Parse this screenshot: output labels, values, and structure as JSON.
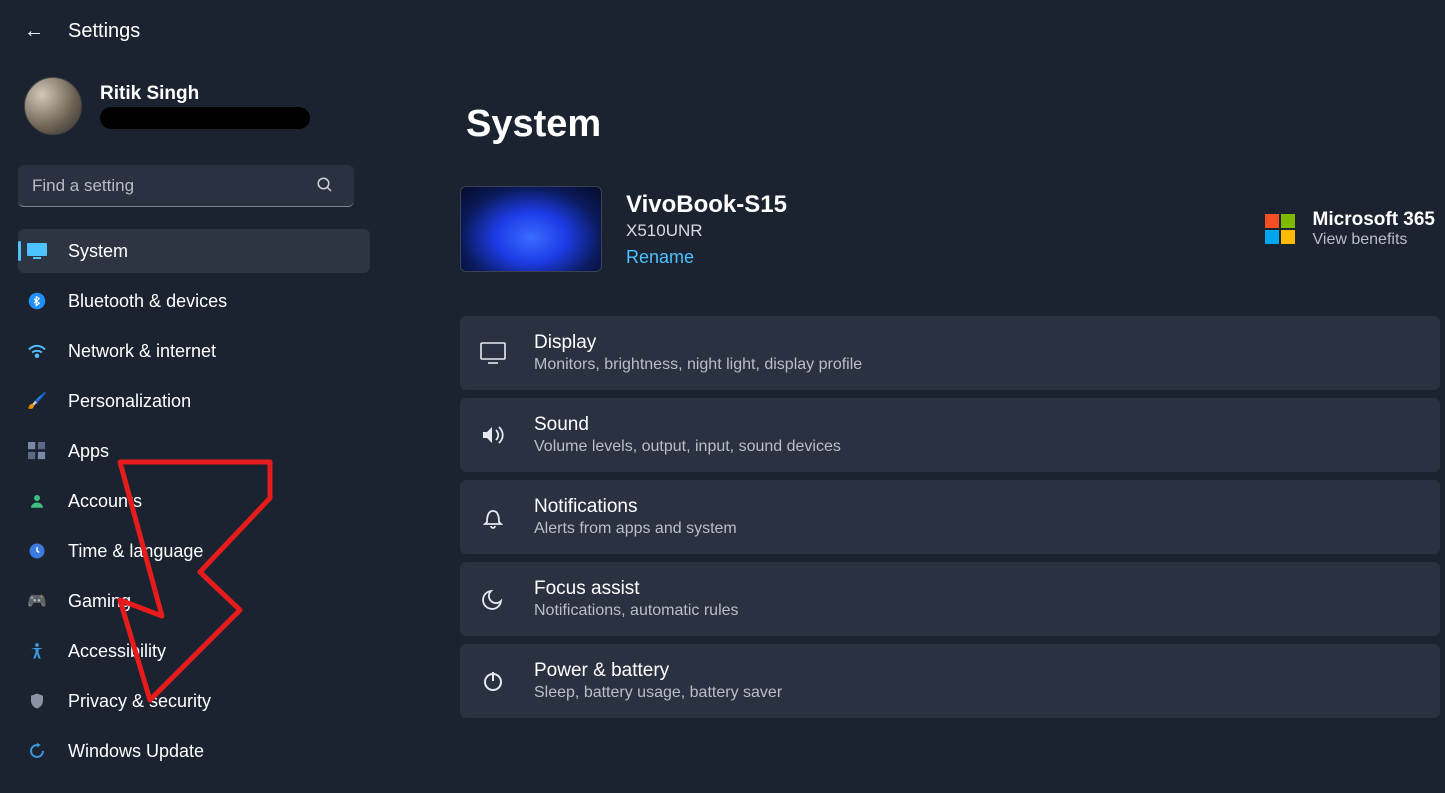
{
  "header": {
    "title": "Settings"
  },
  "user": {
    "name": "Ritik Singh"
  },
  "search": {
    "placeholder": "Find a setting"
  },
  "sidebar": {
    "items": [
      {
        "label": "System",
        "icon": "🖥️",
        "active": true
      },
      {
        "label": "Bluetooth & devices",
        "icon": "bt"
      },
      {
        "label": "Network & internet",
        "icon": "wifi"
      },
      {
        "label": "Personalization",
        "icon": "🖌️"
      },
      {
        "label": "Apps",
        "icon": "▦"
      },
      {
        "label": "Accounts",
        "icon": "👤"
      },
      {
        "label": "Time & language",
        "icon": "🕒"
      },
      {
        "label": "Gaming",
        "icon": "🎮"
      },
      {
        "label": "Accessibility",
        "icon": "acc"
      },
      {
        "label": "Privacy & security",
        "icon": "🛡️"
      },
      {
        "label": "Windows Update",
        "icon": "🔄"
      }
    ]
  },
  "page": {
    "title": "System",
    "device": {
      "name": "VivoBook-S15",
      "model": "X510UNR",
      "rename_label": "Rename"
    },
    "ms365": {
      "title": "Microsoft 365",
      "subtitle": "View benefits"
    },
    "cards": [
      {
        "title": "Display",
        "subtitle": "Monitors, brightness, night light, display profile",
        "icon": "display"
      },
      {
        "title": "Sound",
        "subtitle": "Volume levels, output, input, sound devices",
        "icon": "sound"
      },
      {
        "title": "Notifications",
        "subtitle": "Alerts from apps and system",
        "icon": "bell"
      },
      {
        "title": "Focus assist",
        "subtitle": "Notifications, automatic rules",
        "icon": "moon"
      },
      {
        "title": "Power & battery",
        "subtitle": "Sleep, battery usage, battery saver",
        "icon": "power"
      }
    ]
  }
}
